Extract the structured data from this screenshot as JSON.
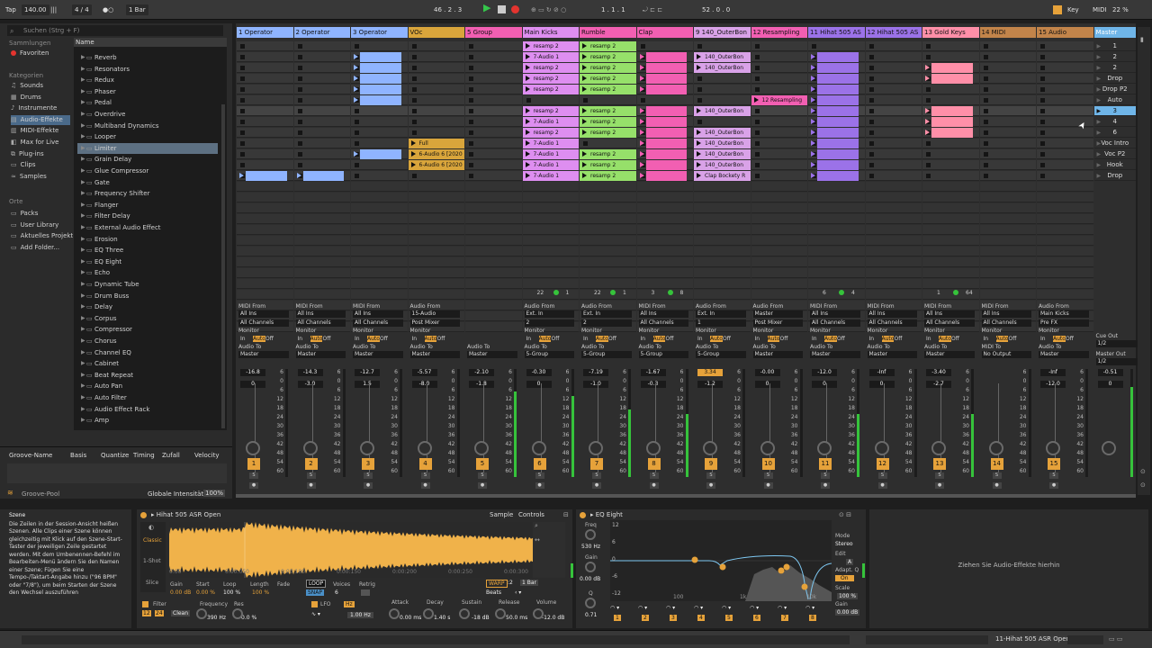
{
  "topbar": {
    "tap": "Tap",
    "tempo": "140.00",
    "sig": "4 / 4",
    "quant": "1 Bar",
    "pos": "46 .  2 .  3",
    "loop_start": "1 .  1 .  1",
    "loop_len": "52 .  0 .  0",
    "key": "Key",
    "midi": "MIDI",
    "cpu": "22 %"
  },
  "browser": {
    "search_placeholder": "Suchen (Strg + F)",
    "collections_title": "Sammlungen",
    "favorites": "Favoriten",
    "categories_title": "Kategorien",
    "categories": [
      "Sounds",
      "Drums",
      "Instrumente",
      "Audio-Effekte",
      "MIDI-Effekte",
      "Max for Live",
      "Plug-ins",
      "Clips",
      "Samples"
    ],
    "places_title": "Orte",
    "places": [
      "Packs",
      "User Library",
      "Aktuelles Projekt",
      "Add Folder..."
    ],
    "name_header": "Name",
    "items": [
      "Reverb",
      "Resonators",
      "Redux",
      "Phaser",
      "Pedal",
      "Overdrive",
      "Multiband Dynamics",
      "Looper",
      "Limiter",
      "Grain Delay",
      "Glue Compressor",
      "Gate",
      "Frequency Shifter",
      "Flanger",
      "Filter Delay",
      "External Audio Effect",
      "Erosion",
      "EQ Three",
      "EQ Eight",
      "Echo",
      "Dynamic Tube",
      "Drum Buss",
      "Delay",
      "Corpus",
      "Compressor",
      "Chorus",
      "Channel EQ",
      "Cabinet",
      "Beat Repeat",
      "Auto Pan",
      "Auto Filter",
      "Audio Effect Rack",
      "Amp"
    ],
    "selected_item": "Limiter"
  },
  "groove": {
    "headers": [
      "Groove-Name",
      "Basis",
      "Quantize",
      "Timing",
      "Zufall",
      "Velocity"
    ],
    "pool": "Groove-Pool",
    "global": "Globale Intensität",
    "global_val": "100%"
  },
  "tracks": [
    {
      "name": "1 Operator",
      "color": "#8fb4ff",
      "vol": "-16.8",
      "pan": "0",
      "num": "1",
      "mon_type": "MIDI From",
      "in1": "All Ins",
      "in2": "All Channels",
      "out": "Master"
    },
    {
      "name": "2 Operator",
      "color": "#8fb4ff",
      "vol": "-14.3",
      "pan": "-3.0",
      "num": "2",
      "mon_type": "MIDI From",
      "in1": "All Ins",
      "in2": "All Channels",
      "out": "Master"
    },
    {
      "name": "3 Operator",
      "color": "#8fb4ff",
      "vol": "-12.7",
      "pan": "1.5",
      "num": "3",
      "mon_type": "MIDI From",
      "in1": "All Ins",
      "in2": "All Channels",
      "out": "Master"
    },
    {
      "name": "VOc",
      "color": "#d9a53b",
      "vol": "-5.57",
      "pan": "-8.0",
      "num": "4",
      "mon_type": "Audio From",
      "in1": "15-Audio",
      "in2": "Post Mixer",
      "out": "Master"
    },
    {
      "name": "5 Group",
      "color": "#f25fb2",
      "vol": "-2.10",
      "pan": "-1.8",
      "num": "5",
      "mon_type": "",
      "in1": "",
      "in2": "",
      "out": "Master"
    },
    {
      "name": "Main Kicks",
      "color": "#de8ef0",
      "vol": "-0.30",
      "pan": "0",
      "num": "6",
      "mon_type": "Audio From",
      "in1": "Ext. In",
      "in2": "2",
      "out": "5-Group"
    },
    {
      "name": "Rumble",
      "color": "#f25fb2",
      "vol": "-7.19",
      "pan": "-1.0",
      "num": "7",
      "mon_type": "Audio From",
      "in1": "Ext. In",
      "in2": "2",
      "out": "5-Group"
    },
    {
      "name": "Clap",
      "color": "#f25fb2",
      "vol": "-1.67",
      "pan": "-0.3",
      "num": "8",
      "mon_type": "MIDI From",
      "in1": "All Ins",
      "in2": "All Channels",
      "out": "5-Group"
    },
    {
      "name": "9 140_OuterBon",
      "color": "#d9a2e8",
      "vol": "3.34",
      "pan": "-1.2",
      "num": "9",
      "mon_type": "Audio From",
      "in1": "Ext. In",
      "in2": "1",
      "out": "5-Group"
    },
    {
      "name": "12 Resampling",
      "color": "#f25fb2",
      "vol": "-0.00",
      "pan": "0",
      "num": "10",
      "mon_type": "Audio From",
      "in1": "Master",
      "in2": "Post Mixer",
      "out": "Master"
    },
    {
      "name": "11 Hihat 505 AS",
      "color": "#9b72e8",
      "vol": "-12.0",
      "pan": "0",
      "num": "11",
      "mon_type": "MIDI From",
      "in1": "All Ins",
      "in2": "All Channels",
      "out": "Master"
    },
    {
      "name": "12 Hihat 505 AS",
      "color": "#9b72e8",
      "vol": "-Inf",
      "pan": "0",
      "num": "12",
      "mon_type": "MIDI From",
      "in1": "All Ins",
      "in2": "All Channels",
      "out": "Master"
    },
    {
      "name": "13 Gold Keys",
      "color": "#ff8fa8",
      "vol": "-3.40",
      "pan": "-2.7",
      "num": "13",
      "mon_type": "MIDI From",
      "in1": "All Ins",
      "in2": "All Channels",
      "out": "Master"
    },
    {
      "name": "14 MIDI",
      "color": "#c2844a",
      "vol": "",
      "pan": "",
      "num": "14",
      "mon_type": "MIDI From",
      "in1": "All Ins",
      "in2": "All Channels",
      "out": "No Output"
    },
    {
      "name": "15 Audio",
      "color": "#c2844a",
      "vol": "-Inf",
      "pan": "-12.0",
      "num": "15",
      "mon_type": "Audio From",
      "in1": "Main Kicks",
      "in2": "Pre FX",
      "out": "Master"
    }
  ],
  "master": {
    "name": "Master",
    "color": "#6fb5e8",
    "vol": "-0.51",
    "pan": "0",
    "cue_out": "Cue Out",
    "cue_val": "1/2",
    "master_out": "Master Out",
    "master_val": "1/2"
  },
  "scenes": [
    "1",
    "2",
    "2",
    "Drop",
    "Drop P2",
    "Auto",
    "3",
    "4",
    "6",
    "Voc Intro",
    "Voc P2",
    "Hook",
    "Drop"
  ],
  "clips": {
    "resamp": "resamp 2",
    "audio7": "7-Audio 1",
    "outer": "140_OuterBon",
    "resampling": "12 Resampling",
    "full": "Full",
    "audio6": "6-Audio 6 [2020",
    "clap_bockety": "Clap Bockety R"
  },
  "mixer_labels": {
    "monitor": "Monitor",
    "in": "In",
    "auto": "Auto",
    "off": "Off",
    "audio_to": "Audio To",
    "midi_to": "MIDI To",
    "s": "S"
  },
  "counts": {
    "kicks_a": "22",
    "kicks_b": "1",
    "rumble_a": "22",
    "rumble_b": "1",
    "clap_a": "3",
    "clap_b": "8",
    "hihat_a": "6",
    "hihat_b": "4",
    "keys_a": "1",
    "keys_b": "64"
  },
  "info": {
    "title": "Szene",
    "text": "Die Zeilen in der Session-Ansicht heißen Szenen. Alle Clips einer Szene können gleichzeitig mit Klick auf den Szene-Start-Taster der jeweiligen Zeile gestartet werden. Mit dem Umbenennen-Befehl im Bearbeiten-Menü ändern Sie den Namen einer Szene; Fügen Sie eine Tempo-/Taktart-Angabe hinzu (\"96 BPM\" oder \"7/8\"), um beim Starten der Szene den Wechsel auszuführen"
  },
  "clipview": {
    "title": "Hihat 505 ASR Open",
    "tab_sample": "Sample",
    "tab_controls": "Controls",
    "classic": "Classic",
    "one_shot": "1-Shot",
    "slice": "Slice",
    "ticks": [
      "0:00",
      "0:00:050",
      "0:00:100",
      "0:00:150",
      "0:00:200",
      "0:00:250",
      "0:00:300"
    ],
    "gain_l": "Gain",
    "gain_v": "0.00 dB",
    "start_l": "Start",
    "start_v": "0.00 %",
    "loop_l": "Loop",
    "loop_v": "100 %",
    "length_l": "Length",
    "length_v": "100 %",
    "fade_l": "Fade",
    "loop_btn": "LOOP",
    "snap_btn": "SNAP",
    "voices_l": "Voices",
    "voices_v": "6",
    "retrig_l": "Retrig",
    "warp": "WARP",
    "beats": "Beats",
    "bar": "1 Bar",
    "filter_l": "Filter",
    "freq_l": "Frequency",
    "res_l": "Res",
    "clean": "Clean",
    "freq_v": "390 Hz",
    "res_v": "0.0 %",
    "f12": "12",
    "f24": "24",
    "lfo": "LFO",
    "hz": "Hz",
    "lfo_v": "1.00 Hz",
    "attack_l": "Attack",
    "attack_v": "0.00 ms",
    "decay_l": "Decay",
    "decay_v": "1.40 s",
    "sustain_l": "Sustain",
    "sustain_v": "-18 dB",
    "release_l": "Release",
    "release_v": "50.0 ms",
    "volume_l": "Volume",
    "volume_v": "-12.0 dB"
  },
  "eq": {
    "title": "EQ Eight",
    "freq_l": "Freq",
    "freq_v": "530 Hz",
    "gain_l": "Gain",
    "gain_v": "0.00 dB",
    "q_l": "Q",
    "q_v": "0.71",
    "mode_l": "Mode",
    "mode_v": "Stereo",
    "edit_l": "Edit",
    "edit_v": "A",
    "adapt_l": "Adapt. Q",
    "adapt_v": "On",
    "scale_l": "Scale",
    "scale_v": "100 %",
    "gain2_l": "Gain",
    "gain2_v": "0.00 dB",
    "y_ticks": [
      "12",
      "6",
      "0",
      "-6",
      "-12"
    ],
    "x_ticks": [
      "100",
      "1k",
      "10k"
    ],
    "bands": [
      "1",
      "2",
      "3",
      "4",
      "5",
      "6",
      "7",
      "8"
    ]
  },
  "dropzone": "Ziehen Sie Audio-Effekte hierhin",
  "status": {
    "track": "11-Hihat 505 ASR Open"
  }
}
